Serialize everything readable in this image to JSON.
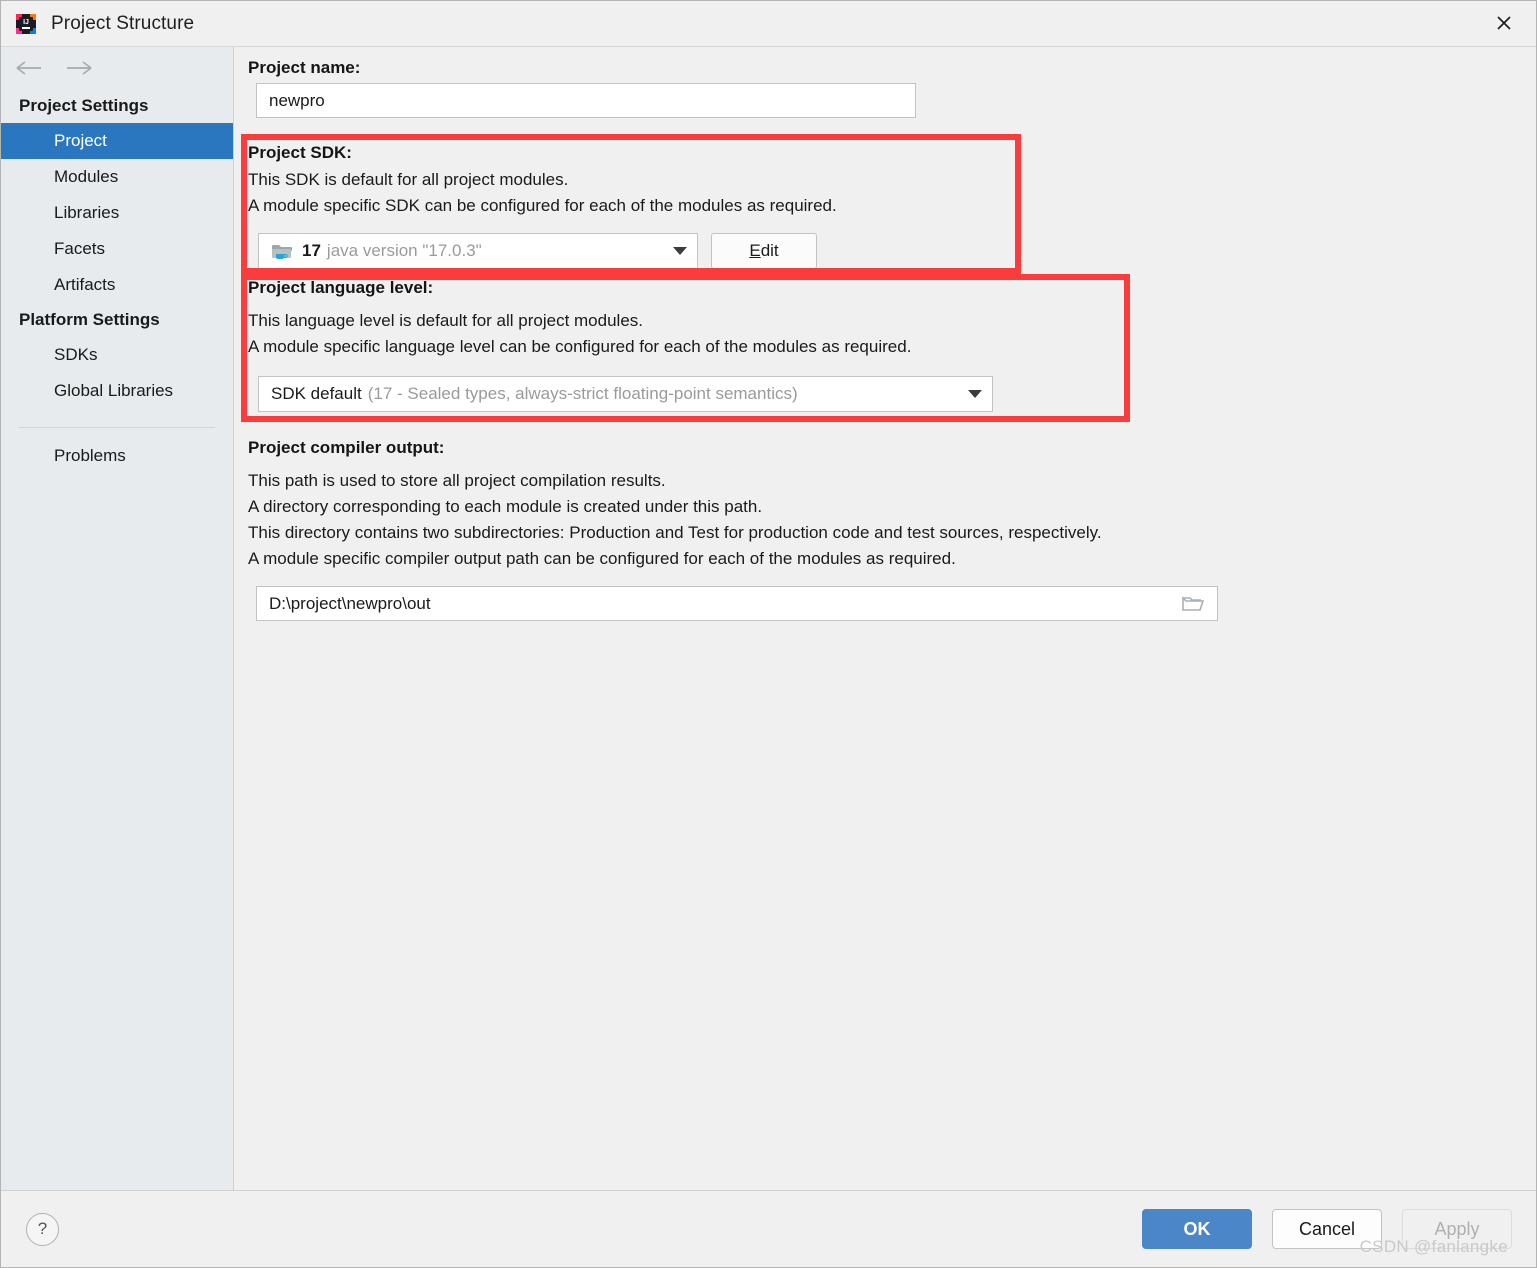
{
  "window": {
    "title": "Project Structure",
    "app_icon": "intellij-idea-logo-icon",
    "close_icon": "close-icon"
  },
  "sidebar": {
    "back_icon": "arrow-left-icon",
    "forward_icon": "arrow-right-icon",
    "groups": [
      {
        "header": "Project Settings",
        "items": [
          {
            "label": "Project",
            "selected": true
          },
          {
            "label": "Modules",
            "selected": false
          },
          {
            "label": "Libraries",
            "selected": false
          },
          {
            "label": "Facets",
            "selected": false
          },
          {
            "label": "Artifacts",
            "selected": false
          }
        ]
      },
      {
        "header": "Platform Settings",
        "items": [
          {
            "label": "SDKs",
            "selected": false
          },
          {
            "label": "Global Libraries",
            "selected": false
          }
        ]
      }
    ],
    "problems": {
      "label": "Problems",
      "selected": false
    }
  },
  "main": {
    "project_name": {
      "label": "Project name:",
      "value": "newpro"
    },
    "project_sdk": {
      "label": "Project SDK:",
      "desc_line1": "This SDK is default for all project modules.",
      "desc_line2": "A module specific SDK can be configured for each of the modules as required.",
      "sdk_icon": "java-sdk-folder-icon",
      "value_bold": "17",
      "value_dim": "java version \"17.0.3\"",
      "dropdown_icon": "chevron-down-icon",
      "edit_button": "Edit",
      "edit_button_mnemonic": "E",
      "edit_button_rest": "dit"
    },
    "language_level": {
      "label": "Project language level:",
      "desc_line1": "This language level is default for all project modules.",
      "desc_line2": "A module specific language level can be configured for each of the modules as required.",
      "value_bold": "SDK default",
      "value_dim": "(17 - Sealed types, always-strict floating-point semantics)",
      "dropdown_icon": "chevron-down-icon"
    },
    "compiler_output": {
      "label": "Project compiler output:",
      "desc_line1": "This path is used to store all project compilation results.",
      "desc_line2": "A directory corresponding to each module is created under this path.",
      "desc_line3": "This directory contains two subdirectories: Production and Test for production code and test sources, respectively.",
      "desc_line4": "A module specific compiler output path can be configured for each of the modules as required.",
      "value": "D:\\project\\newpro\\out",
      "browse_icon": "folder-browse-icon"
    }
  },
  "annotations": {
    "highlight_color": "#fa3c3c",
    "boxes": [
      {
        "name": "project-sdk-highlight"
      },
      {
        "name": "project-language-level-highlight"
      }
    ]
  },
  "footer": {
    "help_icon": "question-mark-icon",
    "ok_label": "OK",
    "cancel_label": "Cancel",
    "apply_label": "Apply",
    "watermark": "CSDN @fanlangke"
  },
  "colors": {
    "selection_blue": "#2a77c0",
    "primary_button": "#4a86c8",
    "annotation_red": "#fa3c3c",
    "sidebar_bg": "#e7ebee",
    "content_bg": "#f0f0f0"
  }
}
